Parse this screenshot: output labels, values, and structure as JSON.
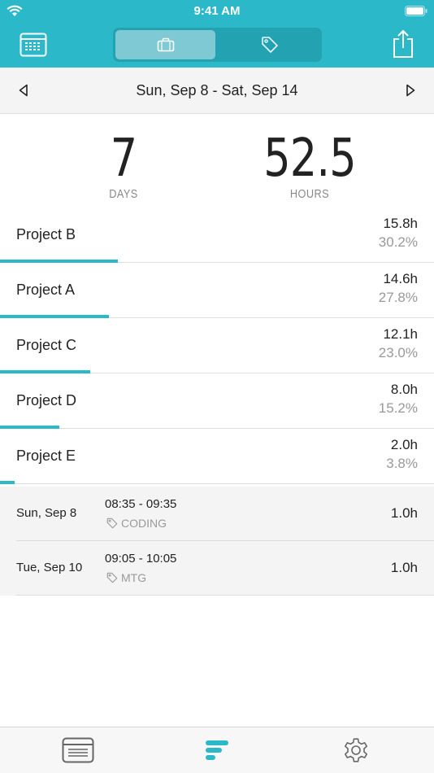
{
  "status": {
    "time": "9:41 AM"
  },
  "header": {
    "segments": [
      {
        "icon": "briefcase-icon",
        "selected": true
      },
      {
        "icon": "tag-icon",
        "selected": false
      }
    ],
    "left_icon": "calendar-icon",
    "right_icon": "share-icon"
  },
  "date_range": "Sun, Sep 8 - Sat, Sep 14",
  "summary": {
    "days_value": "7",
    "days_label": "DAYS",
    "hours_value": "52.5",
    "hours_label": "HOURS"
  },
  "projects": [
    {
      "name": "Project B",
      "hours": "15.8h",
      "percent": "30.2%",
      "share": 0.302
    },
    {
      "name": "Project A",
      "hours": "14.6h",
      "percent": "27.8%",
      "share": 0.278
    },
    {
      "name": "Project C",
      "hours": "12.1h",
      "percent": "23.0%",
      "share": 0.23
    },
    {
      "name": "Project D",
      "hours": "8.0h",
      "percent": "15.2%",
      "share": 0.152
    },
    {
      "name": "Project E",
      "hours": "2.0h",
      "percent": "3.8%",
      "share": 0.038
    }
  ],
  "entries": [
    {
      "date": "Sun, Sep 8",
      "time": "08:35 - 09:35",
      "tag": "CODING",
      "hours": "1.0h"
    },
    {
      "date": "Tue, Sep 10",
      "time": "09:05 - 10:05",
      "tag": "MTG",
      "hours": "1.0h"
    }
  ],
  "tabbar": {
    "items": [
      {
        "icon": "list-icon",
        "active": false
      },
      {
        "icon": "stats-icon",
        "active": true
      },
      {
        "icon": "gear-icon",
        "active": false
      }
    ]
  },
  "colors": {
    "accent": "#2bb9c9",
    "muted": "#999999",
    "tab_inactive": "#666666"
  }
}
